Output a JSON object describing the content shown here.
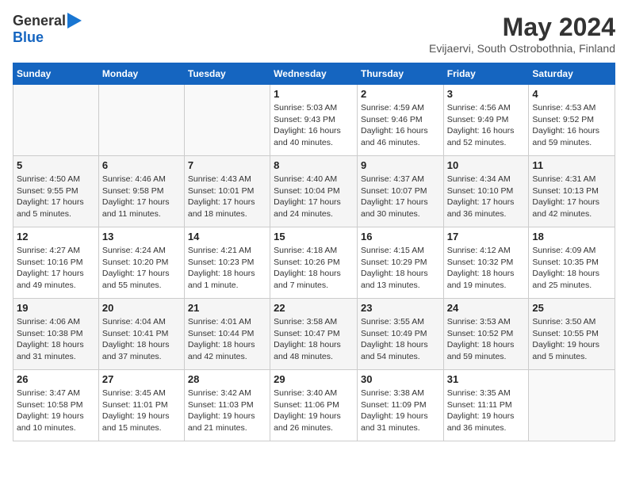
{
  "logo": {
    "general": "General",
    "blue": "Blue"
  },
  "title": "May 2024",
  "subtitle": "Evijaervi, South Ostrobothnia, Finland",
  "days_of_week": [
    "Sunday",
    "Monday",
    "Tuesday",
    "Wednesday",
    "Thursday",
    "Friday",
    "Saturday"
  ],
  "weeks": [
    [
      {
        "day": "",
        "info": ""
      },
      {
        "day": "",
        "info": ""
      },
      {
        "day": "",
        "info": ""
      },
      {
        "day": "1",
        "info": "Sunrise: 5:03 AM\nSunset: 9:43 PM\nDaylight: 16 hours\nand 40 minutes."
      },
      {
        "day": "2",
        "info": "Sunrise: 4:59 AM\nSunset: 9:46 PM\nDaylight: 16 hours\nand 46 minutes."
      },
      {
        "day": "3",
        "info": "Sunrise: 4:56 AM\nSunset: 9:49 PM\nDaylight: 16 hours\nand 52 minutes."
      },
      {
        "day": "4",
        "info": "Sunrise: 4:53 AM\nSunset: 9:52 PM\nDaylight: 16 hours\nand 59 minutes."
      }
    ],
    [
      {
        "day": "5",
        "info": "Sunrise: 4:50 AM\nSunset: 9:55 PM\nDaylight: 17 hours\nand 5 minutes."
      },
      {
        "day": "6",
        "info": "Sunrise: 4:46 AM\nSunset: 9:58 PM\nDaylight: 17 hours\nand 11 minutes."
      },
      {
        "day": "7",
        "info": "Sunrise: 4:43 AM\nSunset: 10:01 PM\nDaylight: 17 hours\nand 18 minutes."
      },
      {
        "day": "8",
        "info": "Sunrise: 4:40 AM\nSunset: 10:04 PM\nDaylight: 17 hours\nand 24 minutes."
      },
      {
        "day": "9",
        "info": "Sunrise: 4:37 AM\nSunset: 10:07 PM\nDaylight: 17 hours\nand 30 minutes."
      },
      {
        "day": "10",
        "info": "Sunrise: 4:34 AM\nSunset: 10:10 PM\nDaylight: 17 hours\nand 36 minutes."
      },
      {
        "day": "11",
        "info": "Sunrise: 4:31 AM\nSunset: 10:13 PM\nDaylight: 17 hours\nand 42 minutes."
      }
    ],
    [
      {
        "day": "12",
        "info": "Sunrise: 4:27 AM\nSunset: 10:16 PM\nDaylight: 17 hours\nand 49 minutes."
      },
      {
        "day": "13",
        "info": "Sunrise: 4:24 AM\nSunset: 10:20 PM\nDaylight: 17 hours\nand 55 minutes."
      },
      {
        "day": "14",
        "info": "Sunrise: 4:21 AM\nSunset: 10:23 PM\nDaylight: 18 hours\nand 1 minute."
      },
      {
        "day": "15",
        "info": "Sunrise: 4:18 AM\nSunset: 10:26 PM\nDaylight: 18 hours\nand 7 minutes."
      },
      {
        "day": "16",
        "info": "Sunrise: 4:15 AM\nSunset: 10:29 PM\nDaylight: 18 hours\nand 13 minutes."
      },
      {
        "day": "17",
        "info": "Sunrise: 4:12 AM\nSunset: 10:32 PM\nDaylight: 18 hours\nand 19 minutes."
      },
      {
        "day": "18",
        "info": "Sunrise: 4:09 AM\nSunset: 10:35 PM\nDaylight: 18 hours\nand 25 minutes."
      }
    ],
    [
      {
        "day": "19",
        "info": "Sunrise: 4:06 AM\nSunset: 10:38 PM\nDaylight: 18 hours\nand 31 minutes."
      },
      {
        "day": "20",
        "info": "Sunrise: 4:04 AM\nSunset: 10:41 PM\nDaylight: 18 hours\nand 37 minutes."
      },
      {
        "day": "21",
        "info": "Sunrise: 4:01 AM\nSunset: 10:44 PM\nDaylight: 18 hours\nand 42 minutes."
      },
      {
        "day": "22",
        "info": "Sunrise: 3:58 AM\nSunset: 10:47 PM\nDaylight: 18 hours\nand 48 minutes."
      },
      {
        "day": "23",
        "info": "Sunrise: 3:55 AM\nSunset: 10:49 PM\nDaylight: 18 hours\nand 54 minutes."
      },
      {
        "day": "24",
        "info": "Sunrise: 3:53 AM\nSunset: 10:52 PM\nDaylight: 18 hours\nand 59 minutes."
      },
      {
        "day": "25",
        "info": "Sunrise: 3:50 AM\nSunset: 10:55 PM\nDaylight: 19 hours\nand 5 minutes."
      }
    ],
    [
      {
        "day": "26",
        "info": "Sunrise: 3:47 AM\nSunset: 10:58 PM\nDaylight: 19 hours\nand 10 minutes."
      },
      {
        "day": "27",
        "info": "Sunrise: 3:45 AM\nSunset: 11:01 PM\nDaylight: 19 hours\nand 15 minutes."
      },
      {
        "day": "28",
        "info": "Sunrise: 3:42 AM\nSunset: 11:03 PM\nDaylight: 19 hours\nand 21 minutes."
      },
      {
        "day": "29",
        "info": "Sunrise: 3:40 AM\nSunset: 11:06 PM\nDaylight: 19 hours\nand 26 minutes."
      },
      {
        "day": "30",
        "info": "Sunrise: 3:38 AM\nSunset: 11:09 PM\nDaylight: 19 hours\nand 31 minutes."
      },
      {
        "day": "31",
        "info": "Sunrise: 3:35 AM\nSunset: 11:11 PM\nDaylight: 19 hours\nand 36 minutes."
      },
      {
        "day": "",
        "info": ""
      }
    ]
  ]
}
